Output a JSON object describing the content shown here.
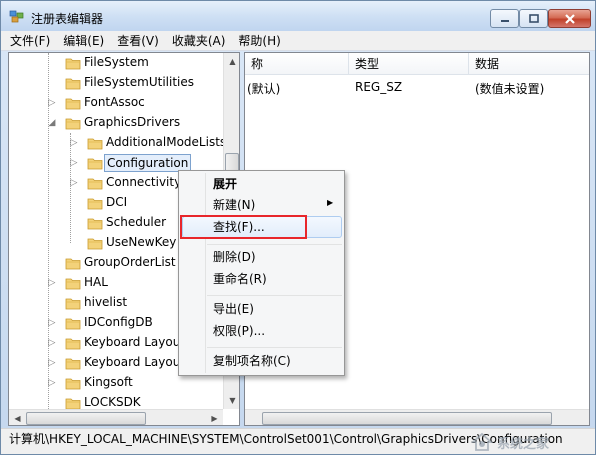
{
  "window": {
    "title": "注册表编辑器",
    "app_icon": "registry-icon",
    "controls": {
      "minimize_icon": "minimize-icon",
      "maximize_icon": "maximize-icon",
      "close_icon": "close-icon"
    }
  },
  "menubar": {
    "items": [
      "文件(F)",
      "编辑(E)",
      "查看(V)",
      "收藏夹(A)",
      "帮助(H)"
    ]
  },
  "tree": {
    "nodes": [
      {
        "label": "FileSystem",
        "level": 2,
        "expander": false
      },
      {
        "label": "FileSystemUtilities",
        "level": 2,
        "expander": false
      },
      {
        "label": "FontAssoc",
        "level": 2,
        "expander": true
      },
      {
        "label": "GraphicsDrivers",
        "level": 2,
        "expander": "open"
      },
      {
        "label": "AdditionalModeLists",
        "level": 3,
        "expander": true
      },
      {
        "label": "Configuration",
        "level": 3,
        "expander": true,
        "selected": true
      },
      {
        "label": "Connectivity",
        "level": 3,
        "expander": true
      },
      {
        "label": "DCI",
        "level": 3,
        "expander": false
      },
      {
        "label": "Scheduler",
        "level": 3,
        "expander": false
      },
      {
        "label": "UseNewKey",
        "level": 3,
        "expander": false
      },
      {
        "label": "GroupOrderList",
        "level": 2,
        "expander": false
      },
      {
        "label": "HAL",
        "level": 2,
        "expander": true
      },
      {
        "label": "hivelist",
        "level": 2,
        "expander": false
      },
      {
        "label": "IDConfigDB",
        "level": 2,
        "expander": true
      },
      {
        "label": "Keyboard Layou",
        "level": 2,
        "expander": true
      },
      {
        "label": "Keyboard Layou",
        "level": 2,
        "expander": true
      },
      {
        "label": "Kingsoft",
        "level": 2,
        "expander": true
      },
      {
        "label": "LOCKSDK",
        "level": 2,
        "expander": false
      }
    ]
  },
  "values_pane": {
    "columns": [
      "称",
      "类型",
      "数据"
    ],
    "rows": [
      {
        "name": "(默认)",
        "type": "REG_SZ",
        "data": "(数值未设置)"
      }
    ]
  },
  "context_menu": {
    "items": [
      {
        "label": "展开",
        "bold": true
      },
      {
        "label": "新建(N)",
        "submenu": true
      },
      {
        "label": "查找(F)...",
        "highlighted": true
      },
      {
        "label": "删除(D)"
      },
      {
        "label": "重命名(R)"
      },
      {
        "label": "导出(E)"
      },
      {
        "label": "权限(P)..."
      },
      {
        "label": "复制项名称(C)"
      }
    ]
  },
  "statusbar": {
    "path": "计算机\\HKEY_LOCAL_MACHINE\\SYSTEM\\ControlSet001\\Control\\GraphicsDrivers\\Configuration"
  },
  "watermark": {
    "text": "系统之家"
  },
  "colors": {
    "highlight_box": "#e8262b",
    "selection_border": "#7da2ce",
    "folder": "#e8c25a"
  }
}
